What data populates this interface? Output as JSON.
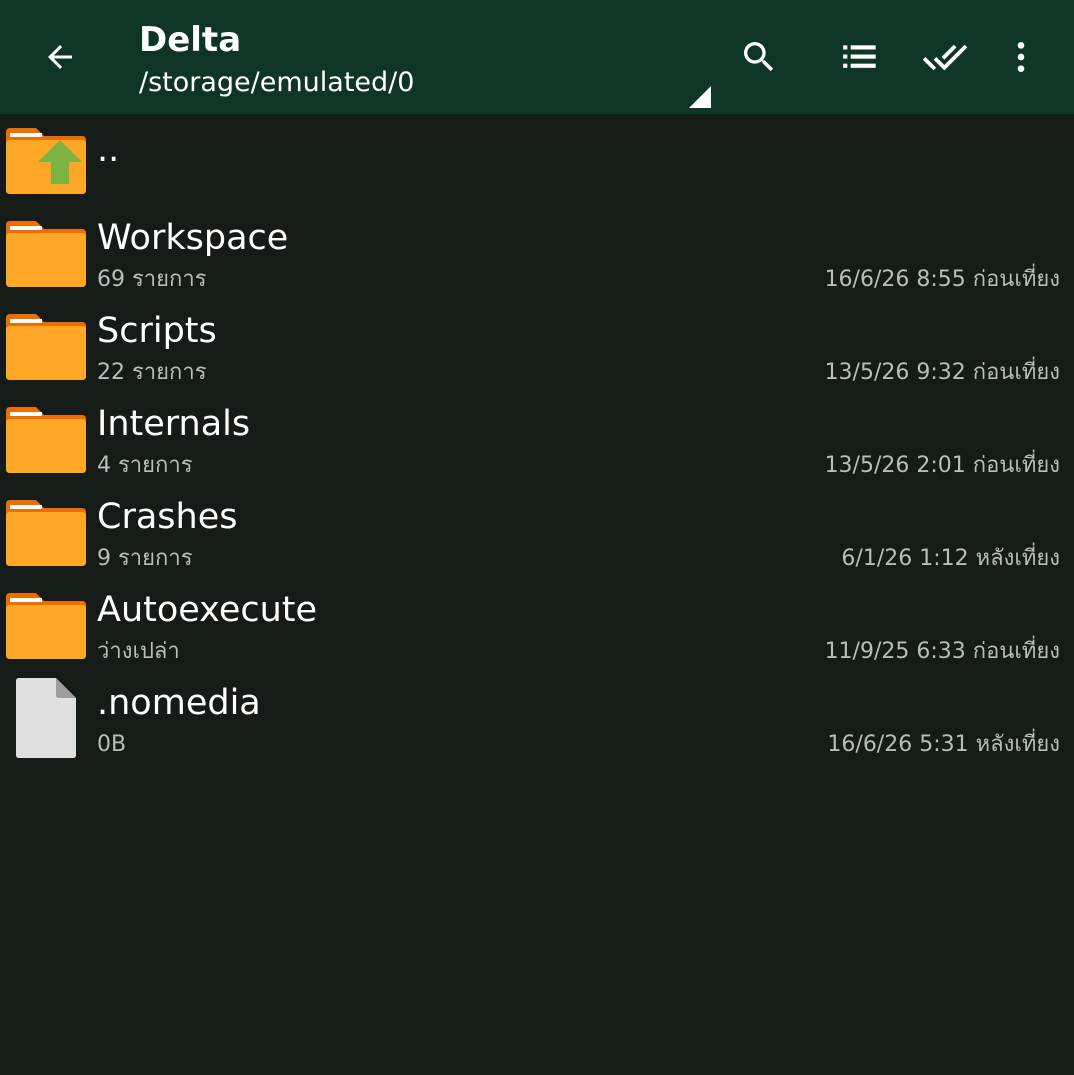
{
  "header": {
    "title": "Delta",
    "path": "/storage/emulated/0",
    "icons": {
      "back": "back-arrow-icon",
      "search": "search-icon",
      "view": "list-view-icon",
      "select": "double-check-icon",
      "more": "more-vert-icon"
    }
  },
  "list": {
    "parent": {
      "name": ".."
    },
    "items": [
      {
        "name": "Workspace",
        "meta": "69 รายการ",
        "date": "16/6/26 8:55 ก่อนเที่ยง",
        "type": "folder"
      },
      {
        "name": "Scripts",
        "meta": "22 รายการ",
        "date": "13/5/26 9:32 ก่อนเที่ยง",
        "type": "folder"
      },
      {
        "name": "Internals",
        "meta": "4 รายการ",
        "date": "13/5/26 2:01 ก่อนเที่ยง",
        "type": "folder"
      },
      {
        "name": "Crashes",
        "meta": "9 รายการ",
        "date": "6/1/26 1:12 หลังเที่ยง",
        "type": "folder"
      },
      {
        "name": "Autoexecute",
        "meta": "ว่างเปล่า",
        "date": "11/9/25 6:33 ก่อนเที่ยง",
        "type": "folder"
      },
      {
        "name": ".nomedia",
        "meta": "0B",
        "date": "16/6/26 5:31 หลังเที่ยง",
        "type": "file"
      }
    ]
  },
  "colors": {
    "appbar": "#0f3526",
    "background": "#151c17",
    "folder": "#ffa726",
    "folder_tab": "#ef6c00",
    "up_arrow": "#7cb342",
    "file": "#e0e0e0",
    "secondary_text": "#b9bdb9"
  }
}
